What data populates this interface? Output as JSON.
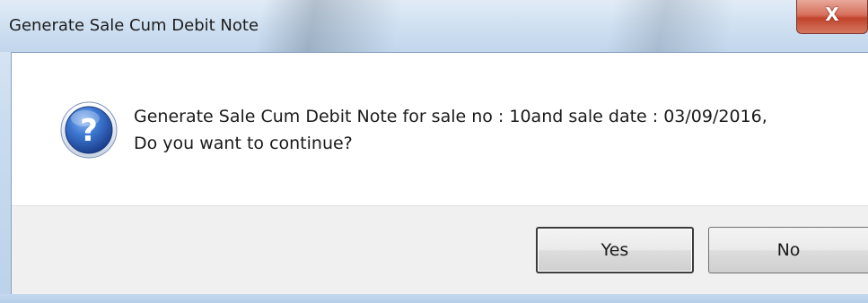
{
  "window": {
    "title": "Generate Sale Cum Debit Note",
    "close_icon": "close-icon",
    "close_glyph": "X"
  },
  "dialog": {
    "icon": "question-icon",
    "message_line1": "Generate Sale Cum Debit Note for sale no : 10and sale date : 03/09/2016,",
    "message_line2": "Do you want to continue?",
    "yes_label": "Yes",
    "no_label": "No"
  },
  "colors": {
    "accent_close": "#c1442c",
    "icon_blue": "#2f63b8",
    "frame": "#bcd2ea"
  }
}
